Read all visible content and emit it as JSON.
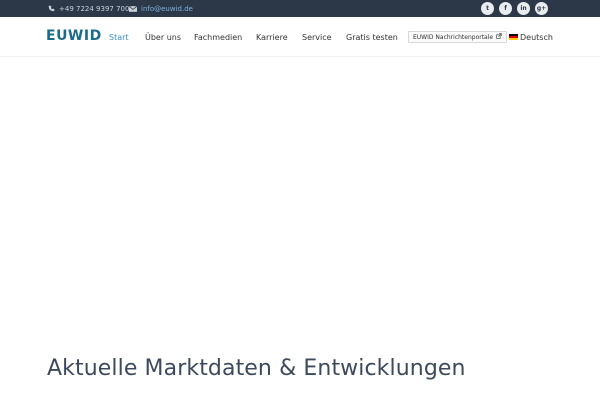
{
  "topbar": {
    "phone": "+49 7224 9397 700",
    "email": "info@euwid.de",
    "phone_icon": "phone-icon",
    "mail_icon": "envelope-icon",
    "social": [
      {
        "name": "twitter-icon",
        "glyph": "t"
      },
      {
        "name": "facebook-icon",
        "glyph": "f"
      },
      {
        "name": "linkedin-icon",
        "glyph": "in"
      },
      {
        "name": "google-plus-icon",
        "glyph": "g+"
      }
    ]
  },
  "nav": {
    "logo": "EUWID",
    "items": [
      {
        "label": "Start",
        "active": true
      },
      {
        "label": "Über uns",
        "active": false
      },
      {
        "label": "Fachmedien",
        "active": false
      },
      {
        "label": "Karriere",
        "active": false
      },
      {
        "label": "Service",
        "active": false
      },
      {
        "label": "Gratis testen",
        "active": false
      }
    ],
    "portal_label": "EUWID Nachrichtenportale",
    "language": "Deutsch"
  },
  "main": {
    "headline": "Aktuelle Marktdaten & Entwicklungen"
  },
  "colors": {
    "topbar_bg": "#2c3847",
    "accent": "#3a8fd0",
    "logo": "#1b6b8a"
  }
}
